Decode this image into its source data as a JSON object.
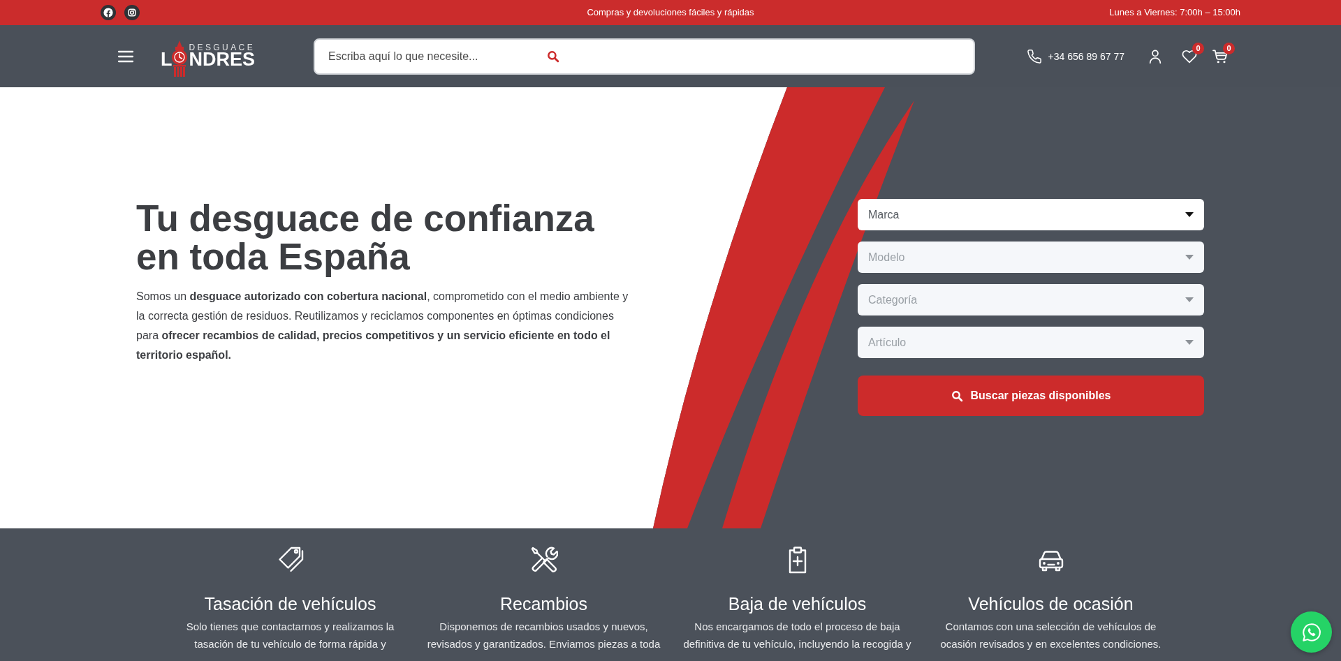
{
  "top_bar": {
    "social": [
      {
        "kind": "facebook"
      },
      {
        "kind": "instagram"
      }
    ],
    "message": "Compras y devoluciones fáciles y rápidas",
    "hours": "Lunes a Viernes: 7:00h – 15:00h"
  },
  "header": {
    "logo": {
      "tagline": "DESGUACE",
      "initial": "L",
      "rest": "NDRES"
    },
    "search": {
      "placeholder": "Escriba aquí lo que necesite..."
    },
    "phone": "+34 656 89 67 77",
    "wishlist_count": "0",
    "cart_count": "0"
  },
  "hero": {
    "title": "Tu desguace de confianza en toda España",
    "text": "Somos un **desguace autorizado con cobertura nacional**, comprometido con el medio ambiente y la correcta gestión de residuos. Reutilizamos y reciclamos componentes en óptimas condiciones para **ofrecer recambios de calidad, precios competitivos y un servicio eficiente en todo el territorio español.**"
  },
  "search_form": {
    "selects": [
      {
        "placeholder": "Marca",
        "disabled": false
      },
      {
        "placeholder": "Modelo",
        "disabled": true
      },
      {
        "placeholder": "Categoría",
        "disabled": true
      },
      {
        "placeholder": "Artículo",
        "disabled": true
      }
    ],
    "button": "Buscar piezas disponibles"
  },
  "features": [
    {
      "kind": "tags",
      "title": "Tasación de vehículos",
      "text": "Solo tienes que contactarnos y realizamos la tasación de tu vehículo de forma rápida y"
    },
    {
      "kind": "tools",
      "title": "Recambios",
      "text": "Disponemos de recambios usados y nuevos, revisados y garantizados. Enviamos piezas a toda"
    },
    {
      "kind": "clipboard",
      "title": "Baja de vehículos",
      "text": "Nos encargamos de todo el proceso de baja definitiva de tu vehículo, incluyendo la recogida y"
    },
    {
      "kind": "car",
      "title": "Vehículos de ocasión",
      "text": "Contamos con una selección de vehículos de ocasión revisados y en excelentes condiciones."
    }
  ]
}
